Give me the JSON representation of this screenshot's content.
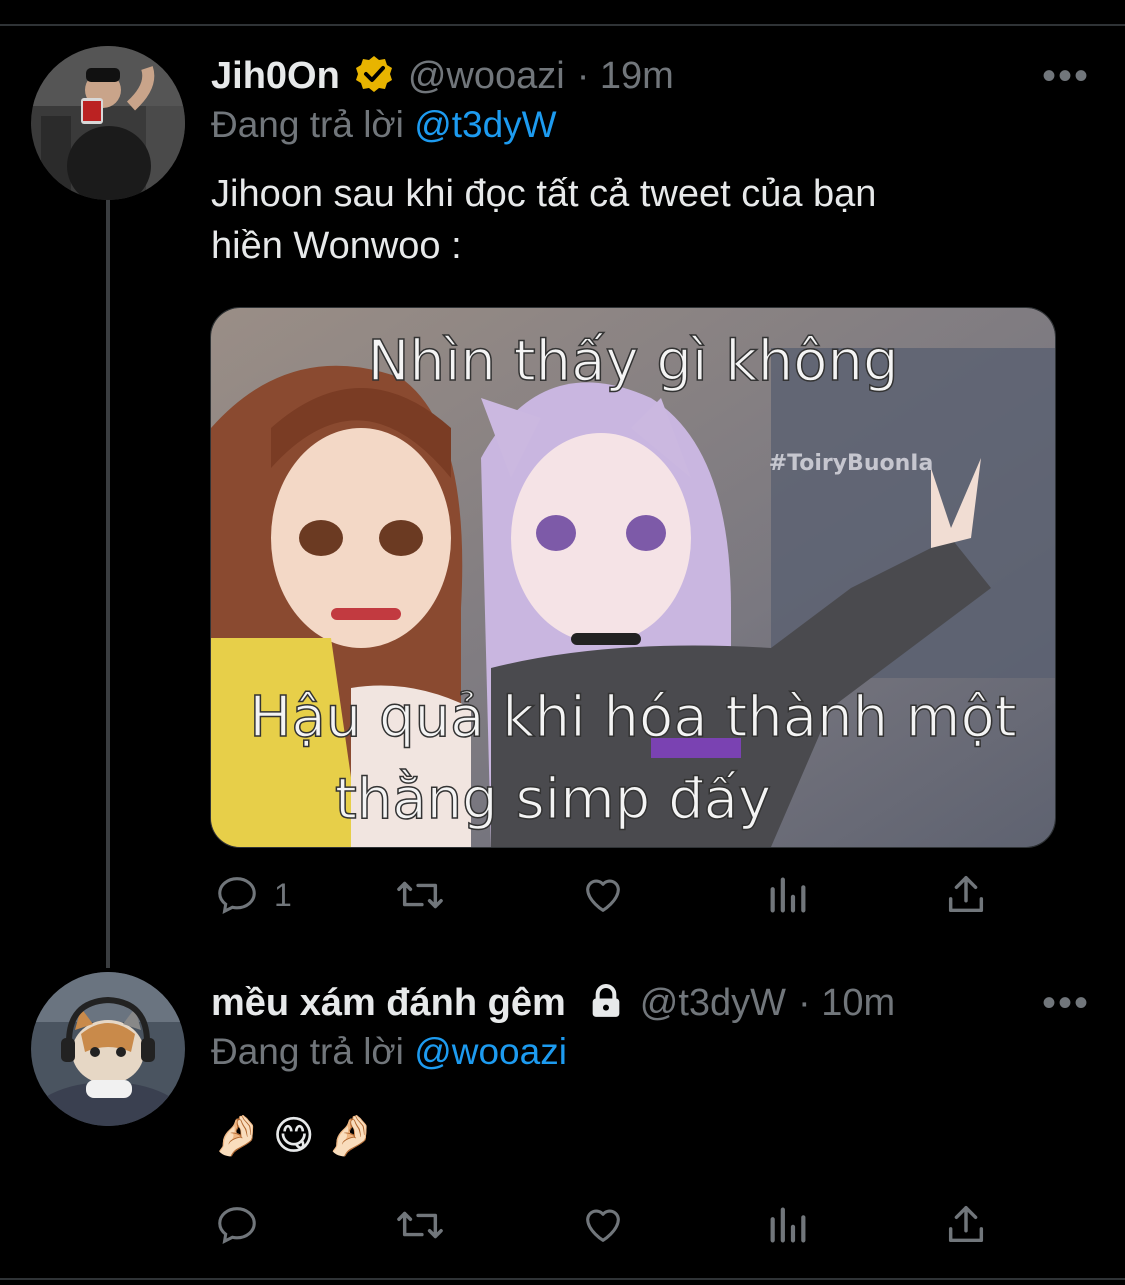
{
  "tweets": [
    {
      "display_name": "Jih0On",
      "handle": "@wooazi",
      "time": "· 19m",
      "verified": true,
      "reply_label": "Đang trả lời",
      "reply_to": "@t3dyW",
      "text_line1": "Jihoon sau khi đọc tất cả tweet của bạn",
      "text_line2": "hiền Wonwoo :",
      "media": {
        "caption_top": "Nhìn thấy gì không",
        "watermark": "#ToiryBuonIa",
        "caption_mid": "Hậu quả khi hóa thành một",
        "caption_bottom": "thằng simp đấy"
      },
      "reply_count": "1",
      "more": "•••"
    },
    {
      "display_name": "mều xám đánh gêm",
      "handle": "@t3dyW",
      "time": "· 10m",
      "locked": true,
      "reply_label": "Đang trả lời",
      "reply_to": "@wooazi",
      "text": "🤌🏻 😋 🤌🏻",
      "reply_count": "",
      "more": "•••"
    }
  ],
  "icons": [
    "reply-icon",
    "retweet-icon",
    "like-icon",
    "analytics-icon",
    "share-icon"
  ],
  "colors": {
    "background": "#000000",
    "text": "#e7e9ea",
    "muted": "#71767b",
    "link": "#1d9bf0",
    "verified": "#e8b400"
  }
}
